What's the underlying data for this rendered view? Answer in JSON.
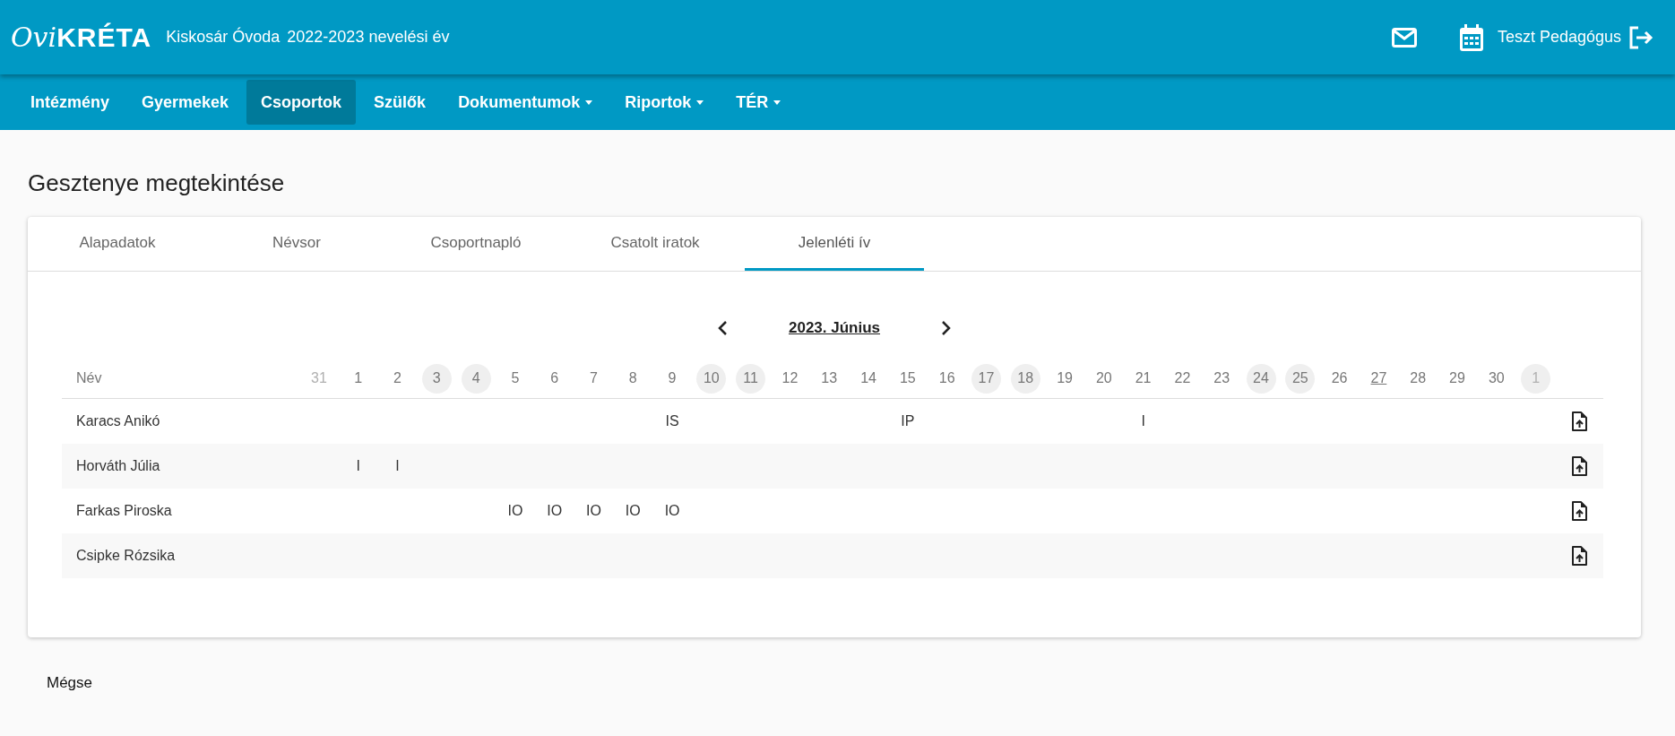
{
  "header": {
    "logo": {
      "prefix": "Ovi",
      "name": "KRÉTA"
    },
    "institution": "Kiskosár Óvoda",
    "school_year": "2022-2023 nevelési év",
    "user": "Teszt Pedagógus"
  },
  "nav": [
    {
      "label": "Intézmény",
      "selected": false,
      "dropdown": false
    },
    {
      "label": "Gyermekek",
      "selected": false,
      "dropdown": false
    },
    {
      "label": "Csoportok",
      "selected": true,
      "dropdown": false
    },
    {
      "label": "Szülők",
      "selected": false,
      "dropdown": false
    },
    {
      "label": "Dokumentumok",
      "selected": false,
      "dropdown": true
    },
    {
      "label": "Riportok",
      "selected": false,
      "dropdown": true
    },
    {
      "label": "TÉR",
      "selected": false,
      "dropdown": true
    }
  ],
  "page_title": "Gesztenye megtekintése",
  "tabs": [
    {
      "label": "Alapadatok",
      "selected": false
    },
    {
      "label": "Névsor",
      "selected": false
    },
    {
      "label": "Csoportnapló",
      "selected": false
    },
    {
      "label": "Csatolt iratok",
      "selected": false
    },
    {
      "label": "Jelenléti ív",
      "selected": true
    }
  ],
  "calendar": {
    "month": "2023. Június",
    "name_header": "Név",
    "days": [
      {
        "label": "31",
        "outside": true,
        "weekend": false,
        "today": false
      },
      {
        "label": "1",
        "outside": false,
        "weekend": false,
        "today": false
      },
      {
        "label": "2",
        "outside": false,
        "weekend": false,
        "today": false
      },
      {
        "label": "3",
        "outside": false,
        "weekend": true,
        "today": false
      },
      {
        "label": "4",
        "outside": false,
        "weekend": true,
        "today": false
      },
      {
        "label": "5",
        "outside": false,
        "weekend": false,
        "today": false
      },
      {
        "label": "6",
        "outside": false,
        "weekend": false,
        "today": false
      },
      {
        "label": "7",
        "outside": false,
        "weekend": false,
        "today": false
      },
      {
        "label": "8",
        "outside": false,
        "weekend": false,
        "today": false
      },
      {
        "label": "9",
        "outside": false,
        "weekend": false,
        "today": false
      },
      {
        "label": "10",
        "outside": false,
        "weekend": true,
        "today": false
      },
      {
        "label": "11",
        "outside": false,
        "weekend": true,
        "today": false
      },
      {
        "label": "12",
        "outside": false,
        "weekend": false,
        "today": false
      },
      {
        "label": "13",
        "outside": false,
        "weekend": false,
        "today": false
      },
      {
        "label": "14",
        "outside": false,
        "weekend": false,
        "today": false
      },
      {
        "label": "15",
        "outside": false,
        "weekend": false,
        "today": false
      },
      {
        "label": "16",
        "outside": false,
        "weekend": false,
        "today": false
      },
      {
        "label": "17",
        "outside": false,
        "weekend": true,
        "today": false
      },
      {
        "label": "18",
        "outside": false,
        "weekend": true,
        "today": false
      },
      {
        "label": "19",
        "outside": false,
        "weekend": false,
        "today": false
      },
      {
        "label": "20",
        "outside": false,
        "weekend": false,
        "today": false
      },
      {
        "label": "21",
        "outside": false,
        "weekend": false,
        "today": false
      },
      {
        "label": "22",
        "outside": false,
        "weekend": false,
        "today": false
      },
      {
        "label": "23",
        "outside": false,
        "weekend": false,
        "today": false
      },
      {
        "label": "24",
        "outside": false,
        "weekend": true,
        "today": false
      },
      {
        "label": "25",
        "outside": false,
        "weekend": true,
        "today": false
      },
      {
        "label": "26",
        "outside": false,
        "weekend": false,
        "today": false
      },
      {
        "label": "27",
        "outside": false,
        "weekend": false,
        "today": true
      },
      {
        "label": "28",
        "outside": false,
        "weekend": false,
        "today": false
      },
      {
        "label": "29",
        "outside": false,
        "weekend": false,
        "today": false
      },
      {
        "label": "30",
        "outside": false,
        "weekend": false,
        "today": false
      },
      {
        "label": "1",
        "outside": true,
        "weekend": true,
        "today": false
      }
    ],
    "rows": [
      {
        "name": "Karacs Anikó",
        "cells": [
          {},
          {},
          {},
          {},
          {},
          {},
          {},
          {},
          {},
          {
            "code": "IS"
          },
          {},
          {},
          {},
          {},
          {},
          {
            "code": "IP"
          },
          {},
          {},
          {},
          {},
          {},
          {
            "code": "I"
          },
          {},
          {},
          {},
          {},
          {},
          {},
          {},
          {},
          {},
          {}
        ]
      },
      {
        "name": "Horváth Júlia",
        "cells": [
          {},
          {
            "code": "I"
          },
          {
            "code": "I"
          },
          {},
          {},
          {},
          {},
          {},
          {},
          {},
          {},
          {},
          {},
          {},
          {},
          {},
          {},
          {},
          {},
          {},
          {},
          {},
          {},
          {},
          {},
          {},
          {},
          {},
          {},
          {},
          {},
          {}
        ]
      },
      {
        "name": "Farkas Piroska",
        "cells": [
          {},
          {},
          {},
          {},
          {},
          {
            "code": "IO"
          },
          {
            "code": "IO"
          },
          {
            "code": "IO"
          },
          {
            "code": "IO"
          },
          {
            "code": "IO"
          },
          {},
          {},
          {},
          {},
          {},
          {},
          {},
          {},
          {},
          {},
          {},
          {},
          {},
          {},
          {},
          {},
          {},
          {},
          {},
          {},
          {},
          {}
        ]
      },
      {
        "name": "Csipke Rózsika",
        "cells": [
          {},
          {},
          {},
          {},
          {},
          {},
          {},
          {},
          {},
          {},
          {},
          {},
          {},
          {},
          {},
          {},
          {},
          {},
          {},
          {},
          {},
          {},
          {},
          {},
          {},
          {},
          {},
          {},
          {},
          {},
          {},
          {}
        ]
      }
    ]
  },
  "cancel_button": "Mégse"
}
